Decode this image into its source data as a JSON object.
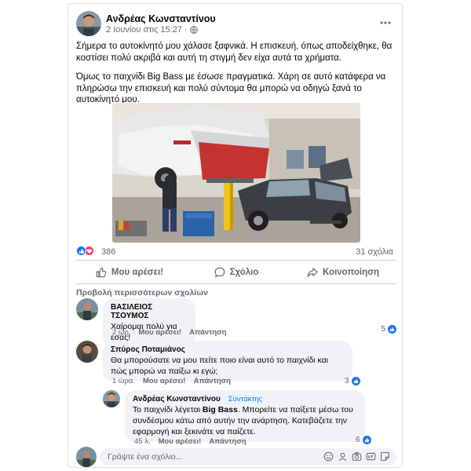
{
  "post": {
    "author": "Ανδρέας Κωνσταντίνου",
    "date": "2 Ιουνίου στις 15:27",
    "separator": "·",
    "paragraph1": "Σήμερα το αυτοκίνητό μου χάλασε ξαφνικά. Η επισκευή, όπως αποδείχθηκε, θα κοστίσει πολύ ακριβά και αυτή τη στιγμή δεν είχα αυτά τα χρήματα.",
    "paragraph2": "Όμως το παιχνίδι Big Bass με έσωσε πραγματικά. Χάρη σε αυτό κατάφερα να πληρώσω την επισκευή και πολύ σύντομα θα μπορώ να οδηγώ ξανά το αυτοκίνητό μου."
  },
  "reactions": {
    "count": "386",
    "comments_count": "31 σχόλια"
  },
  "actions": {
    "like": "Μου αρέσει!",
    "comment": "Σχόλιο",
    "share": "Κοινοποίηση"
  },
  "more_comments_label": "Προβολή περισσότερων σχολίων",
  "comments": [
    {
      "name": "ΒΑΣΙΛΕΙΟΣ ΤΣΟΥΜΟΣ",
      "text": "Χαίρομαι πολύ για εσάς!",
      "time": "2 ώρ.",
      "like_label": "Μου αρέσει!",
      "reply_label": "Απάντηση",
      "likes": "5"
    },
    {
      "name": "Σπύρος Ποταμιάνος",
      "text": "Θα μπορούσατε να μου πείτε ποιο είναι αυτό το παιχνίδι και πώς μπορώ να παίξω κι εγώ;",
      "time": "1 ώρα.",
      "like_label": "Μου αρέσει!",
      "reply_label": "Απάντηση",
      "likes": "3"
    }
  ],
  "reply": {
    "name": "Ανδρέας Κωνσταντίνου",
    "badge": "Συντάκτης",
    "text_before": "Το παιχνίδι λέγεται ",
    "text_bold": "Big Bass",
    "text_after": ". Μπορείτε να παίξετε μέσω του συνδέσμου κάτω από αυτήν την ανάρτηση. Κατεβάζετε την εφαρμογή και ξεκινάτε να παίζετε.",
    "time": "45 λ.",
    "like_label": "Μου αρέσει!",
    "reply_label": "Απάντηση",
    "likes": "6"
  },
  "compose": {
    "placeholder": "Γράψτε ένα σχόλιο..."
  },
  "colors": {
    "accent": "#1877f2",
    "love": "#f33e58",
    "bubble": "#f0f2f5",
    "meta": "#65676b"
  },
  "icons": {
    "more": "more-horizontal-icon",
    "globe": "globe-icon",
    "like": "thumbs-up-icon",
    "comment": "comment-icon",
    "share": "share-icon",
    "emoji": "emoji-icon",
    "camera": "camera-icon",
    "gif": "gif-icon",
    "sticker": "sticker-icon"
  }
}
